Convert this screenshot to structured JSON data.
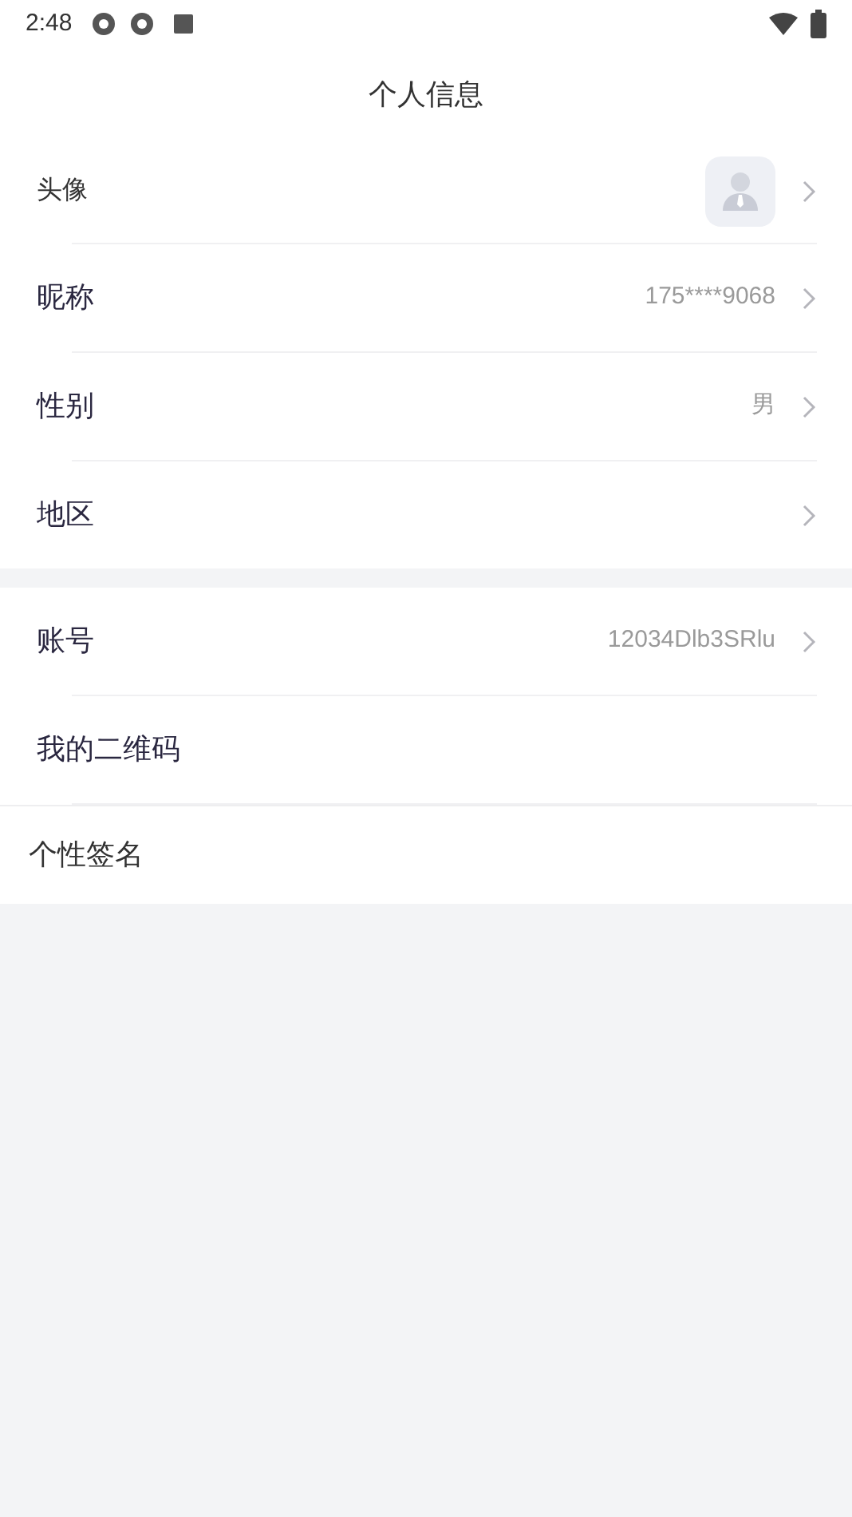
{
  "status_bar": {
    "time": "2:48"
  },
  "title": "个人信息",
  "sections": [
    {
      "rows": [
        {
          "kind": "avatar",
          "label": "头像",
          "chevron": true
        },
        {
          "kind": "text",
          "label": "昵称",
          "value": "175****9068",
          "chevron": true
        },
        {
          "kind": "text",
          "label": "性别",
          "value": "男",
          "chevron": true
        },
        {
          "kind": "text",
          "label": "地区",
          "chevron": true
        }
      ]
    },
    {
      "rows": [
        {
          "kind": "text",
          "label": "账号",
          "value": "12034Dlb3SRlu",
          "chevron": true
        },
        {
          "kind": "text",
          "label": "我的二维码",
          "chevron": false
        }
      ]
    }
  ],
  "signature": {
    "label": "个性签名"
  }
}
